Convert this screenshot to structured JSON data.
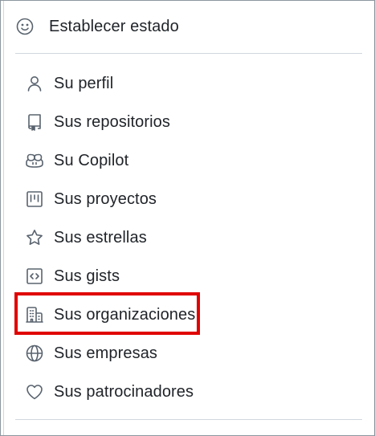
{
  "status": {
    "label": "Establecer estado",
    "icon": "smiley-icon"
  },
  "menu": {
    "items": [
      {
        "label": "Su perfil",
        "icon": "person-icon"
      },
      {
        "label": "Sus repositorios",
        "icon": "repo-icon"
      },
      {
        "label": "Su Copilot",
        "icon": "copilot-icon"
      },
      {
        "label": "Sus proyectos",
        "icon": "project-icon"
      },
      {
        "label": "Sus estrellas",
        "icon": "star-icon"
      },
      {
        "label": "Sus gists",
        "icon": "code-square-icon"
      },
      {
        "label": "Sus organizaciones",
        "icon": "organization-icon",
        "highlighted": true
      },
      {
        "label": "Sus empresas",
        "icon": "globe-icon"
      },
      {
        "label": "Sus patrocinadores",
        "icon": "heart-icon"
      }
    ]
  },
  "colors": {
    "text": "#1f2328",
    "icon": "#59636e",
    "divider": "#d0d7de",
    "highlight": "#e00000"
  }
}
